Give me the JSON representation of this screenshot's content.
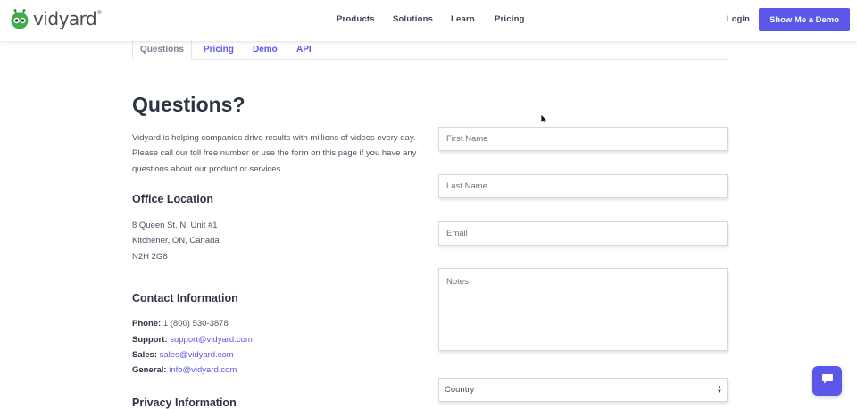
{
  "header": {
    "logo_text": "vidyard",
    "logo_reg": "®",
    "nav": [
      "Products",
      "Solutions",
      "Learn",
      "Pricing"
    ],
    "login": "Login",
    "cta": "Show Me a Demo"
  },
  "tabs": [
    "Questions",
    "Pricing",
    "Demo",
    "API"
  ],
  "main": {
    "title": "Questions?",
    "intro": "Vidyard is helping companies drive results with millions of videos every day. Please call our toll free number or use the form on this page if you have any questions about our product or services.",
    "office_heading": "Office Location",
    "address": [
      "8 Queen St. N, Unit #1",
      "Kitchener, ON, Canada",
      "N2H 2G8"
    ],
    "contact_heading": "Contact Information",
    "contacts": [
      {
        "label": "Phone:",
        "value": "1 (800) 530-3878",
        "link": false
      },
      {
        "label": "Support:",
        "value": "support@vidyard.com",
        "link": true
      },
      {
        "label": "Sales:",
        "value": "sales@vidyard.com",
        "link": true
      },
      {
        "label": "General:",
        "value": "info@vidyard.com",
        "link": true
      }
    ],
    "privacy_heading": "Privacy Information"
  },
  "form": {
    "first_name_placeholder": "First Name",
    "last_name_placeholder": "Last Name",
    "email_placeholder": "Email",
    "notes_placeholder": "Notes",
    "country_value": "Country"
  },
  "colors": {
    "accent": "#5b57e8",
    "logo_green": "#3fae49"
  },
  "icons": {
    "logo": "vidyard-robot-icon",
    "chat": "chat-bubble-icon",
    "select": "updown-arrows-icon",
    "cursor": "mouse-pointer-icon"
  }
}
